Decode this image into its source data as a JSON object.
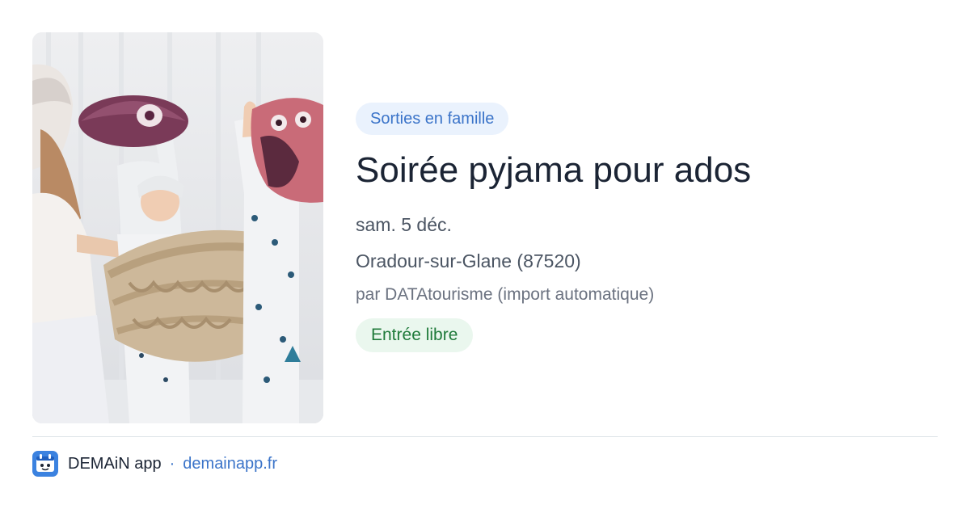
{
  "event": {
    "category": "Sorties en famille",
    "title": "Soirée pyjama pour ados",
    "date": "sam. 5 déc.",
    "location": "Oradour-sur-Glane (87520)",
    "source": "par DATAtourisme (import automatique)",
    "price": "Entrée libre",
    "image_alt": "Enfants en pyjama se battant avec des oreillers"
  },
  "footer": {
    "app_name": "DEMAiN app",
    "separator": "·",
    "site": "demainapp.fr"
  },
  "colors": {
    "accent": "#3b74c9",
    "chip_bg": "#eaf2fd",
    "price_bg": "#eaf7ee",
    "price_text": "#1f7a3a",
    "title": "#1b2434"
  }
}
